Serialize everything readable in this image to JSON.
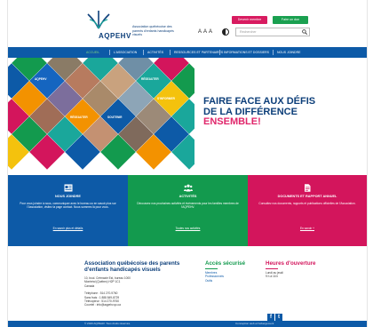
{
  "header": {
    "logo_name": "AQPEHV",
    "logo_tagline": "Association québécoise des parents d'enfants handicapés visuels",
    "btn_become_member": "Devenir membre",
    "btn_donate": "Faire un don",
    "text_size": "A A A",
    "search_placeholder": "Rechercher",
    "icon_search": "search-icon",
    "icon_contrast": "contrast-icon"
  },
  "nav": {
    "items": [
      {
        "label": "ACCUEIL",
        "active": true
      },
      {
        "label": "L'ASSOCIATION"
      },
      {
        "label": "ACTIVITÉS"
      },
      {
        "label": "RESSOURCES ET PARTENAIRES"
      },
      {
        "label": "INFORMATIONS ET DOSSIERS"
      },
      {
        "label": "NOUS JOINDRE"
      }
    ]
  },
  "hero": {
    "title_line1": "FAIRE FACE AUX DÉFIS",
    "title_line2": "DE LA DIFFÉRENCE",
    "title_line3": "ENSEMBLE!",
    "diamond_labels": {
      "a": "AQPEHV",
      "b": "RÉSEAUTER",
      "c": "S'INFORMER",
      "d": "SOUTENIR",
      "e": "RÉSEAUTER"
    },
    "colors": {
      "teal": "#1aa79b",
      "blue": "#1565c0",
      "yellow": "#f4c20d",
      "pink": "#d3155c",
      "orange": "#f39200",
      "green": "#139a4e",
      "navy": "#0d3f7a"
    }
  },
  "cards": [
    {
      "icon": "id-card-icon",
      "title": "Nous joindre",
      "text": "Pour vous joindre à nous, communiquer avec le bureau ou en savoir plus sur l'Association, visitez la page contact. Nous sommes là pour vous.",
      "link": "En savoir plus et détails"
    },
    {
      "icon": "people-icon",
      "title": "Activités",
      "text": "Découvrez nos prochaines activités et évènements pour les familles membres de l'AQPEHV.",
      "link": "Toutes nos activités"
    },
    {
      "icon": "document-icon",
      "title": "Documents et rapport annuel",
      "text": "Consultez nos documents, rapports et publications officielles de l'Association.",
      "link": "En savoir +"
    }
  ],
  "footer": {
    "org_title": "Association québécoise des parents d'enfants handicapés visuels",
    "address": [
      "10, boul. Crémazie Est, bureau 1000",
      "Montréal (Québec) H2P 1C1",
      "Canada"
    ],
    "contact": [
      "Téléphone : 514 270-9760",
      "Sans frais : 1 888 849-8729",
      "Télécopieur : 514 270-9760",
      "Courriel : info@aqpehv.qc.ca"
    ],
    "access_title": "Accès sécurisé",
    "access_links": [
      "Membres",
      "Professionnels",
      "Outils"
    ],
    "hours_title": "Heures d'ouverture",
    "hours": [
      "Lundi au jeudi",
      "9 h à 16 h"
    ],
    "social": [
      "f",
      "t"
    ]
  },
  "bottom": {
    "left": "© 2020 AQPEHV. Tous droits réservés.",
    "right": "Conception web et hébergement"
  }
}
